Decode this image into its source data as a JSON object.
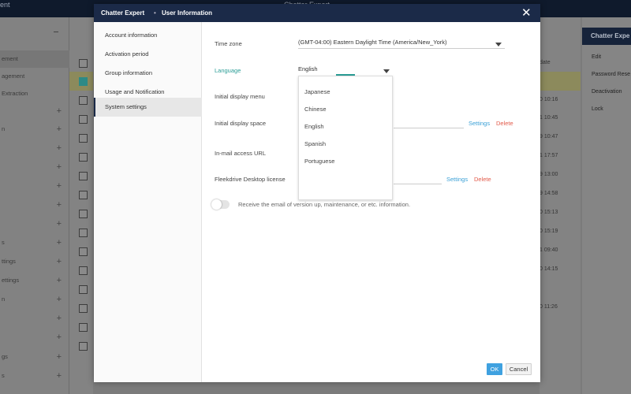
{
  "background": {
    "top_left_text": "ent",
    "top_center_text": "Chatter Expert",
    "left_items": [
      {
        "label": "ement",
        "highlight": true
      },
      {
        "label": "agement"
      },
      {
        "label": "Extraction"
      },
      {
        "label": ""
      },
      {
        "label": "n"
      },
      {
        "label": ""
      },
      {
        "label": ""
      },
      {
        "label": ""
      },
      {
        "label": ""
      },
      {
        "label": ""
      },
      {
        "label": "s"
      },
      {
        "label": "ttings"
      },
      {
        "label": "ettings"
      },
      {
        "label": "n"
      },
      {
        "label": ""
      },
      {
        "label": ""
      },
      {
        "label": "gs"
      },
      {
        "label": "s"
      }
    ],
    "list_header": "date",
    "list_dates": [
      "0 10:16",
      "1 10:45",
      "9 10:47",
      "1 17:57",
      "9 13:00",
      "9 14:58",
      "0 15:13",
      "0 15:19",
      "1 09:40",
      "0 14:15",
      "",
      "0 11:26"
    ],
    "right_panel": {
      "title": "Chatter Expe",
      "items": [
        "Edit",
        "Password Rese",
        "Deactivation",
        "Lock"
      ]
    }
  },
  "modal": {
    "header": {
      "app": "Chatter Expert",
      "separator": "•",
      "title": "User Information"
    },
    "nav": [
      "Account information",
      "Activation period",
      "Group information",
      "Usage and Notification",
      "System settings"
    ],
    "active_nav": "System settings",
    "fields": {
      "time_zone": {
        "label": "Time zone",
        "value": "(GMT-04:00) Eastern Daylight Time (America/New_York)"
      },
      "language": {
        "label": "Language",
        "value": "English"
      },
      "initial_display_menu": {
        "label": "Initial display menu"
      },
      "initial_display_space": {
        "label": "Initial display space",
        "settings": "Settings",
        "delete": "Delete"
      },
      "in_mail_access_url": {
        "label": "In-mail access URL"
      },
      "fleekdrive_license": {
        "label": "Fleekdrive Desktop license",
        "settings": "Settings",
        "delete": "Delete"
      }
    },
    "language_options": [
      "Japanese",
      "Chinese",
      "English",
      "Spanish",
      "Portuguese"
    ],
    "toggle": {
      "label": "Receive the email of version up, maintenance, or etc. information.",
      "on": false
    },
    "buttons": {
      "ok": "OK",
      "cancel": "Cancel"
    }
  },
  "colors": {
    "header": "#1b2a48",
    "accent": "#2a9d96",
    "link": "#3aa0d6",
    "delete": "#e25b4b",
    "ok": "#3fa1e0"
  }
}
